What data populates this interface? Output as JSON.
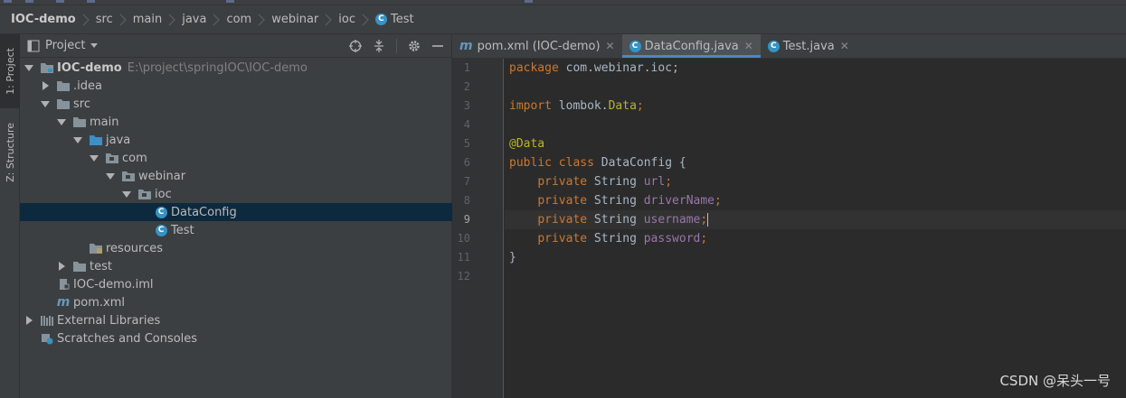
{
  "breadcrumb": [
    "IOC-demo",
    "src",
    "main",
    "java",
    "com",
    "webinar",
    "ioc",
    "Test"
  ],
  "left_strip": {
    "project_tab": "1: Project",
    "structure_tab": "Z: Structure"
  },
  "project_panel": {
    "title": "Project"
  },
  "tree": {
    "root_name": "IOC-demo",
    "root_path": "E:\\project\\springIOC\\IOC-demo",
    "idea": ".idea",
    "src": "src",
    "main": "main",
    "java": "java",
    "com": "com",
    "webinar": "webinar",
    "ioc": "ioc",
    "dataconfig": "DataConfig",
    "test_class": "Test",
    "resources": "resources",
    "test_dir": "test",
    "iml": "IOC-demo.iml",
    "pom": "pom.xml",
    "ext_libs": "External Libraries",
    "scratches": "Scratches and Consoles"
  },
  "tabs": [
    {
      "label": "pom.xml (IOC-demo)"
    },
    {
      "label": "DataConfig.java"
    },
    {
      "label": "Test.java"
    }
  ],
  "line_numbers": [
    "1",
    "2",
    "3",
    "4",
    "5",
    "6",
    "7",
    "8",
    "9",
    "10",
    "11",
    "12"
  ],
  "code": {
    "l1_kw": "package",
    "l1_rest": " com.webinar.ioc;",
    "l3_kw": "import",
    "l3_rest": " lombok.",
    "l3_ann": "Data",
    "l3_end": ";",
    "l5_ann": "@Data",
    "l6_kw": "public class",
    "l6_rest": " DataConfig {",
    "private_kw": "private",
    "string_type": " String ",
    "f_url": "url",
    "f_driver": "driverName",
    "f_user": "username",
    "f_pass": "password",
    "semi": ";",
    "indent": "    ",
    "l11": "}"
  },
  "watermark": "CSDN @呆头一号",
  "colors": {
    "keyword": "#cc7832",
    "annotation": "#bbb529",
    "field": "#9876aa",
    "text": "#a9b7c6",
    "selection": "#0d293e",
    "accent": "#4a88c7"
  }
}
